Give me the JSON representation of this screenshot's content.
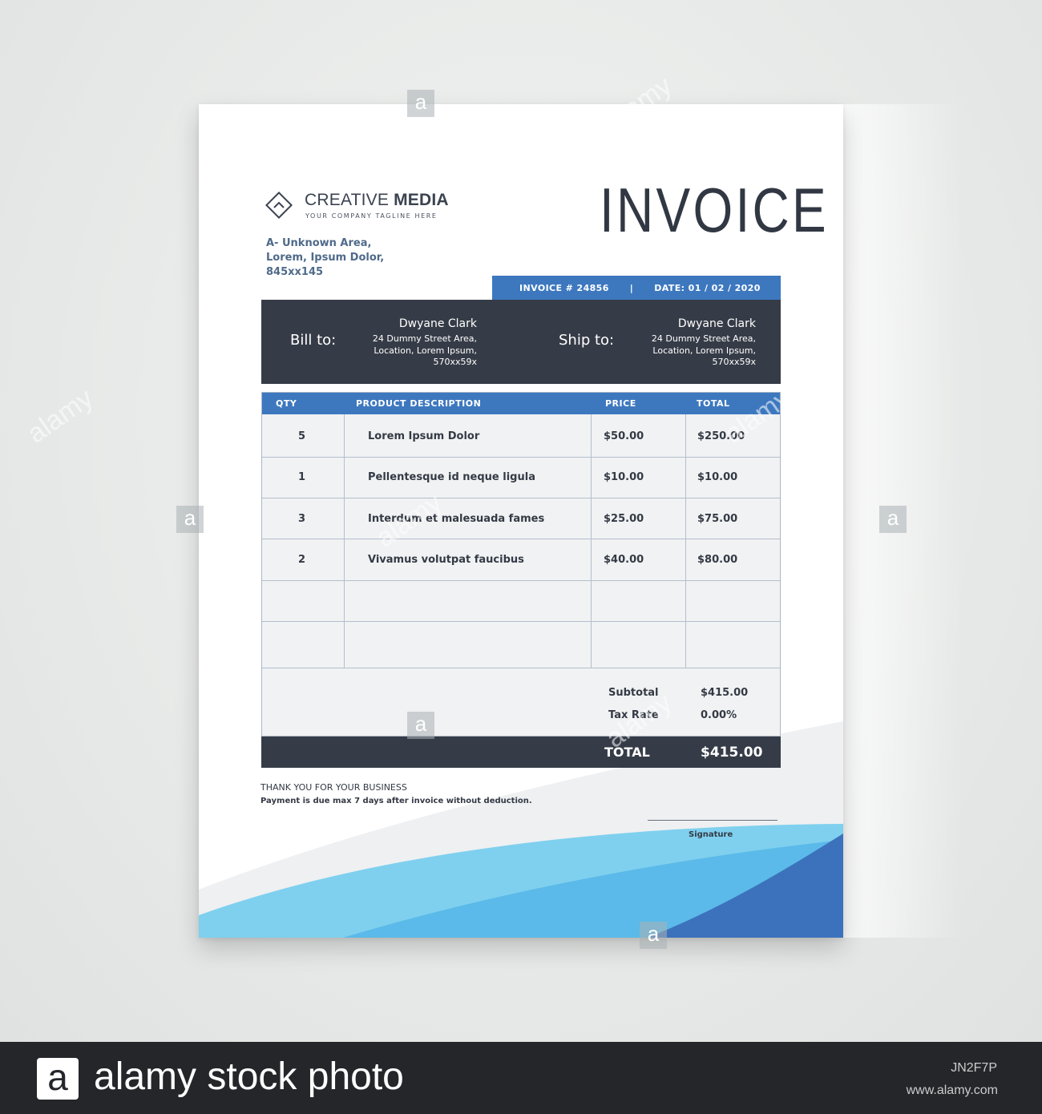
{
  "company": {
    "name_light": "CREATIVE ",
    "name_bold": "MEDIA",
    "tagline": "YOUR COMPANY TAGLINE HERE",
    "address_lines": [
      "A- Unknown Area,",
      "Lorem, Ipsum Dolor,",
      "845xx145"
    ]
  },
  "invoice": {
    "title": "INVOICE",
    "number": "INVOICE # 24856",
    "separator": "|",
    "date": "DATE: 01 / 02 / 2020"
  },
  "bill_to": {
    "label": "Bill to:",
    "name": "Dwyane Clark",
    "address_lines": [
      "24 Dummy Street Area,",
      "Location, Lorem Ipsum,",
      "570xx59x"
    ]
  },
  "ship_to": {
    "label": "Ship to:",
    "name": "Dwyane Clark",
    "address_lines": [
      "24 Dummy Street Area,",
      "Location, Lorem Ipsum,",
      "570xx59x"
    ]
  },
  "table": {
    "headers": [
      "QTY",
      "PRODUCT DESCRIPTION",
      "PRICE",
      "TOTAL"
    ],
    "rows": [
      {
        "qty": "5",
        "description": "Lorem Ipsum Dolor",
        "price": "$50.00",
        "total": "$250.00"
      },
      {
        "qty": "1",
        "description": "Pellentesque id neque ligula",
        "price": "$10.00",
        "total": "$10.00"
      },
      {
        "qty": "3",
        "description": "Interdum et malesuada fames",
        "price": "$25.00",
        "total": "$75.00"
      },
      {
        "qty": "2",
        "description": "Vivamus volutpat faucibus",
        "price": "$40.00",
        "total": "$80.00"
      }
    ]
  },
  "summary": {
    "subtotal_label": "Subtotal",
    "subtotal_value": "$415.00",
    "tax_label": "Tax Rate",
    "tax_value": "0.00%",
    "total_label": "TOTAL",
    "total_value": "$415.00"
  },
  "footer_note": {
    "thanks": "THANK YOU FOR YOUR BUSINESS",
    "terms": "Payment is due max 7 days after invoice without deduction.",
    "signature_label": "Signature"
  },
  "watermark": {
    "word": "alamy",
    "letter": "a"
  },
  "stock_banner": {
    "logo_letter": "a",
    "text": "alamy stock photo",
    "image_id": "JN2F7P",
    "url": "www.alamy.com"
  },
  "colors": {
    "accent_blue": "#3d78bf",
    "dark_slate": "#363c47",
    "wave_light": "#7fd0ee",
    "wave_dark": "#3c72bc"
  }
}
